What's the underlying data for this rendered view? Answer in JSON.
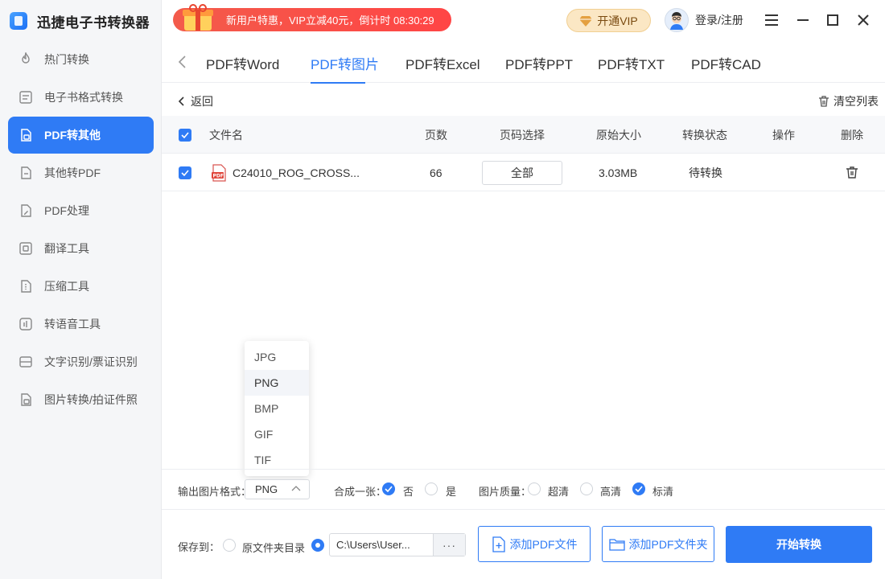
{
  "app": {
    "title": "迅捷电子书转换器"
  },
  "sidebar": {
    "items": [
      {
        "label": "热门转换",
        "icon": "flame-icon",
        "active": false
      },
      {
        "label": "电子书格式转换",
        "icon": "ebook-icon",
        "active": false
      },
      {
        "label": "PDF转其他",
        "icon": "pdf-export-icon",
        "active": true
      },
      {
        "label": "其他转PDF",
        "icon": "to-pdf-icon",
        "active": false
      },
      {
        "label": "PDF处理",
        "icon": "pdf-edit-icon",
        "active": false
      },
      {
        "label": "翻译工具",
        "icon": "translate-icon",
        "active": false
      },
      {
        "label": "压缩工具",
        "icon": "compress-icon",
        "active": false
      },
      {
        "label": "转语音工具",
        "icon": "audio-icon",
        "active": false
      },
      {
        "label": "文字识别/票证识别",
        "icon": "ocr-icon",
        "active": false
      },
      {
        "label": "图片转换/拍证件照",
        "icon": "image-icon",
        "active": false
      }
    ]
  },
  "topbar": {
    "promo_text": "新用户特惠，VIP立减40元，倒计时 08:30:29",
    "vip_label": "开通VIP",
    "user_label": "登录/注册"
  },
  "tabs": {
    "items": [
      {
        "label": "PDF转Word",
        "active": false
      },
      {
        "label": "PDF转图片",
        "active": true
      },
      {
        "label": "PDF转Excel",
        "active": false
      },
      {
        "label": "PDF转PPT",
        "active": false
      },
      {
        "label": "PDF转TXT",
        "active": false
      },
      {
        "label": "PDF转CAD",
        "active": false
      }
    ]
  },
  "content": {
    "back_label": "返回",
    "clear_label": "清空列表"
  },
  "table": {
    "headers": {
      "filename": "文件名",
      "pages": "页数",
      "page_select": "页码选择",
      "size": "原始大小",
      "status": "转换状态",
      "action": "操作",
      "delete": "删除"
    },
    "rows": [
      {
        "filename": "C24010_ROG_CROSS...",
        "pages": "66",
        "page_select": "全部",
        "size": "3.03MB",
        "status": "待转换"
      }
    ]
  },
  "format_dropdown": {
    "options": [
      "JPG",
      "PNG",
      "BMP",
      "GIF",
      "TIF"
    ],
    "selected": "PNG"
  },
  "options": {
    "format_label": "输出图片格式：",
    "format_value": "PNG",
    "merge_label": "合成一张：",
    "merge_no": "否",
    "merge_yes": "是",
    "quality_label": "图片质量：",
    "quality_ultra": "超清",
    "quality_high": "高清",
    "quality_standard": "标清"
  },
  "bottom": {
    "save_label": "保存到：",
    "source_dir_label": "原文件夹目录",
    "path_value": "C:\\Users\\User...",
    "path_more": "···",
    "add_file_label": "添加PDF文件",
    "add_folder_label": "添加PDF文件夹",
    "start_label": "开始转换"
  },
  "colors": {
    "accent": "#2f7bf5",
    "promo": "#f35b4b",
    "vip_bg": "#fbe7c4"
  }
}
